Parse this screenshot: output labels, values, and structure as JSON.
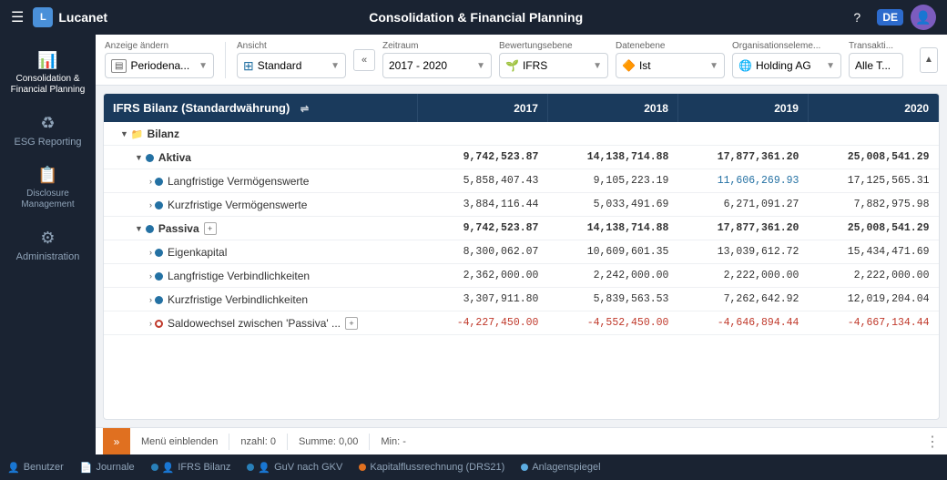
{
  "app": {
    "name": "Lucanet",
    "title": "Consolidation & Financial Planning"
  },
  "topbar": {
    "hamburger_label": "☰",
    "help_icon": "?",
    "lang": "DE",
    "title": "Consolidation & Financial Planning"
  },
  "sidebar": {
    "items": [
      {
        "id": "consolidation",
        "label": "Consolidation & Financial Planning",
        "icon": "📊",
        "active": true
      },
      {
        "id": "esg",
        "label": "ESG Reporting",
        "icon": "♻",
        "active": false
      },
      {
        "id": "disclosure",
        "label": "Disclosure Management",
        "icon": "📋",
        "active": false
      },
      {
        "id": "administration",
        "label": "Administration",
        "icon": "⚙",
        "active": false
      }
    ]
  },
  "filters": {
    "anzeige": {
      "label": "Anzeige ändern",
      "value": "Periodena...",
      "icon": "🔢"
    },
    "ansicht": {
      "label": "Ansicht",
      "value": "Standard",
      "icon": "📊"
    },
    "zeitraum": {
      "label": "Zeitraum",
      "value": "2017 - 2020"
    },
    "bewertungsebene": {
      "label": "Bewertungsebene",
      "value": "IFRS",
      "icon": "🌱"
    },
    "datenebene": {
      "label": "Datenebene",
      "value": "Ist",
      "icon": "🔶"
    },
    "organisationselement": {
      "label": "Organisationseleme...",
      "value": "Holding AG",
      "icon": "🌐"
    },
    "transaktion": {
      "label": "Transakti...",
      "value": "Alle T..."
    }
  },
  "table": {
    "title": "IFRS Bilanz (Standardwährung)",
    "columns": [
      "2017",
      "2018",
      "2019",
      "2020"
    ],
    "rows": [
      {
        "type": "group",
        "indent": 0,
        "label": "Bilanz",
        "values": [
          "",
          "",
          "",
          ""
        ],
        "has_folder": true,
        "expandable": true,
        "expanded": true
      },
      {
        "type": "total",
        "indent": 1,
        "label": "Aktiva",
        "values": [
          "9,742,523.87",
          "14,138,714.88",
          "17,877,361.20",
          "25,008,541.29"
        ],
        "dot": "blue",
        "expandable": true,
        "expanded": true
      },
      {
        "type": "item",
        "indent": 2,
        "label": "Langfristige Vermögenswerte",
        "values": [
          "5,858,407.43",
          "9,105,223.19",
          "11,606,269.93",
          "17,125,565.31"
        ],
        "dot": "blue",
        "expandable": true,
        "val_colors": [
          "black",
          "black",
          "blue",
          "black"
        ]
      },
      {
        "type": "item",
        "indent": 2,
        "label": "Kurzfristige Vermögenswerte",
        "values": [
          "3,884,116.44",
          "5,033,491.69",
          "6,271,091.27",
          "7,882,975.98"
        ],
        "dot": "blue",
        "expandable": true,
        "val_colors": [
          "black",
          "black",
          "black",
          "black"
        ]
      },
      {
        "type": "total",
        "indent": 1,
        "label": "Passiva",
        "values": [
          "9,742,523.87",
          "14,138,714.88",
          "17,877,361.20",
          "25,008,541.29"
        ],
        "dot": "blue",
        "expandable": true,
        "expanded": true,
        "has_expand_icon": true
      },
      {
        "type": "item",
        "indent": 2,
        "label": "Eigenkapital",
        "values": [
          "8,300,062.07",
          "10,609,601.35",
          "13,039,612.72",
          "15,434,471.69"
        ],
        "dot": "blue",
        "expandable": true,
        "val_colors": [
          "black",
          "black",
          "black",
          "black"
        ]
      },
      {
        "type": "item",
        "indent": 2,
        "label": "Langfristige Verbindlichkeiten",
        "values": [
          "2,362,000.00",
          "2,242,000.00",
          "2,222,000.00",
          "2,222,000.00"
        ],
        "dot": "blue",
        "expandable": true,
        "val_colors": [
          "black",
          "black",
          "black",
          "black"
        ]
      },
      {
        "type": "item",
        "indent": 2,
        "label": "Kurzfristige Verbindlichkeiten",
        "values": [
          "3,307,911.80",
          "5,839,563.53",
          "7,262,642.92",
          "12,019,204.04"
        ],
        "dot": "blue",
        "expandable": true,
        "val_colors": [
          "black",
          "black",
          "black",
          "black"
        ]
      },
      {
        "type": "item",
        "indent": 2,
        "label": "Saldowechsel zwischen 'Passiva' ...",
        "values": [
          "-4,227,450.00",
          "-4,552,450.00",
          "-4,646,894.44",
          "-4,667,134.44"
        ],
        "dot": "red",
        "expandable": true,
        "has_expand_icon": true,
        "val_colors": [
          "red",
          "red",
          "red",
          "red"
        ]
      }
    ]
  },
  "status_bar": {
    "menu_label": "Menü einblenden",
    "anzahl_label": "nzahl: 0",
    "summe_label": "Summe: 0,00",
    "min_label": "Min: -"
  },
  "footer_tabs": [
    {
      "id": "benutzer",
      "label": "Benutzer",
      "icon": "👤",
      "dot_color": null
    },
    {
      "id": "journale",
      "label": "Journale",
      "icon": "📄",
      "dot_color": null
    },
    {
      "id": "ifrs",
      "label": "IFRS Bilanz",
      "icon": "👤",
      "dot_color": "#2980b9"
    },
    {
      "id": "guv",
      "label": "GuV nach GKV",
      "icon": "👤",
      "dot_color": "#2980b9"
    },
    {
      "id": "kapital",
      "label": "Kapitalflussrechnung (DRS21)",
      "icon": "●",
      "dot_color": "#e07020"
    },
    {
      "id": "anlage",
      "label": "Anlagenspiegel",
      "icon": "●",
      "dot_color": "#5dade2"
    }
  ]
}
